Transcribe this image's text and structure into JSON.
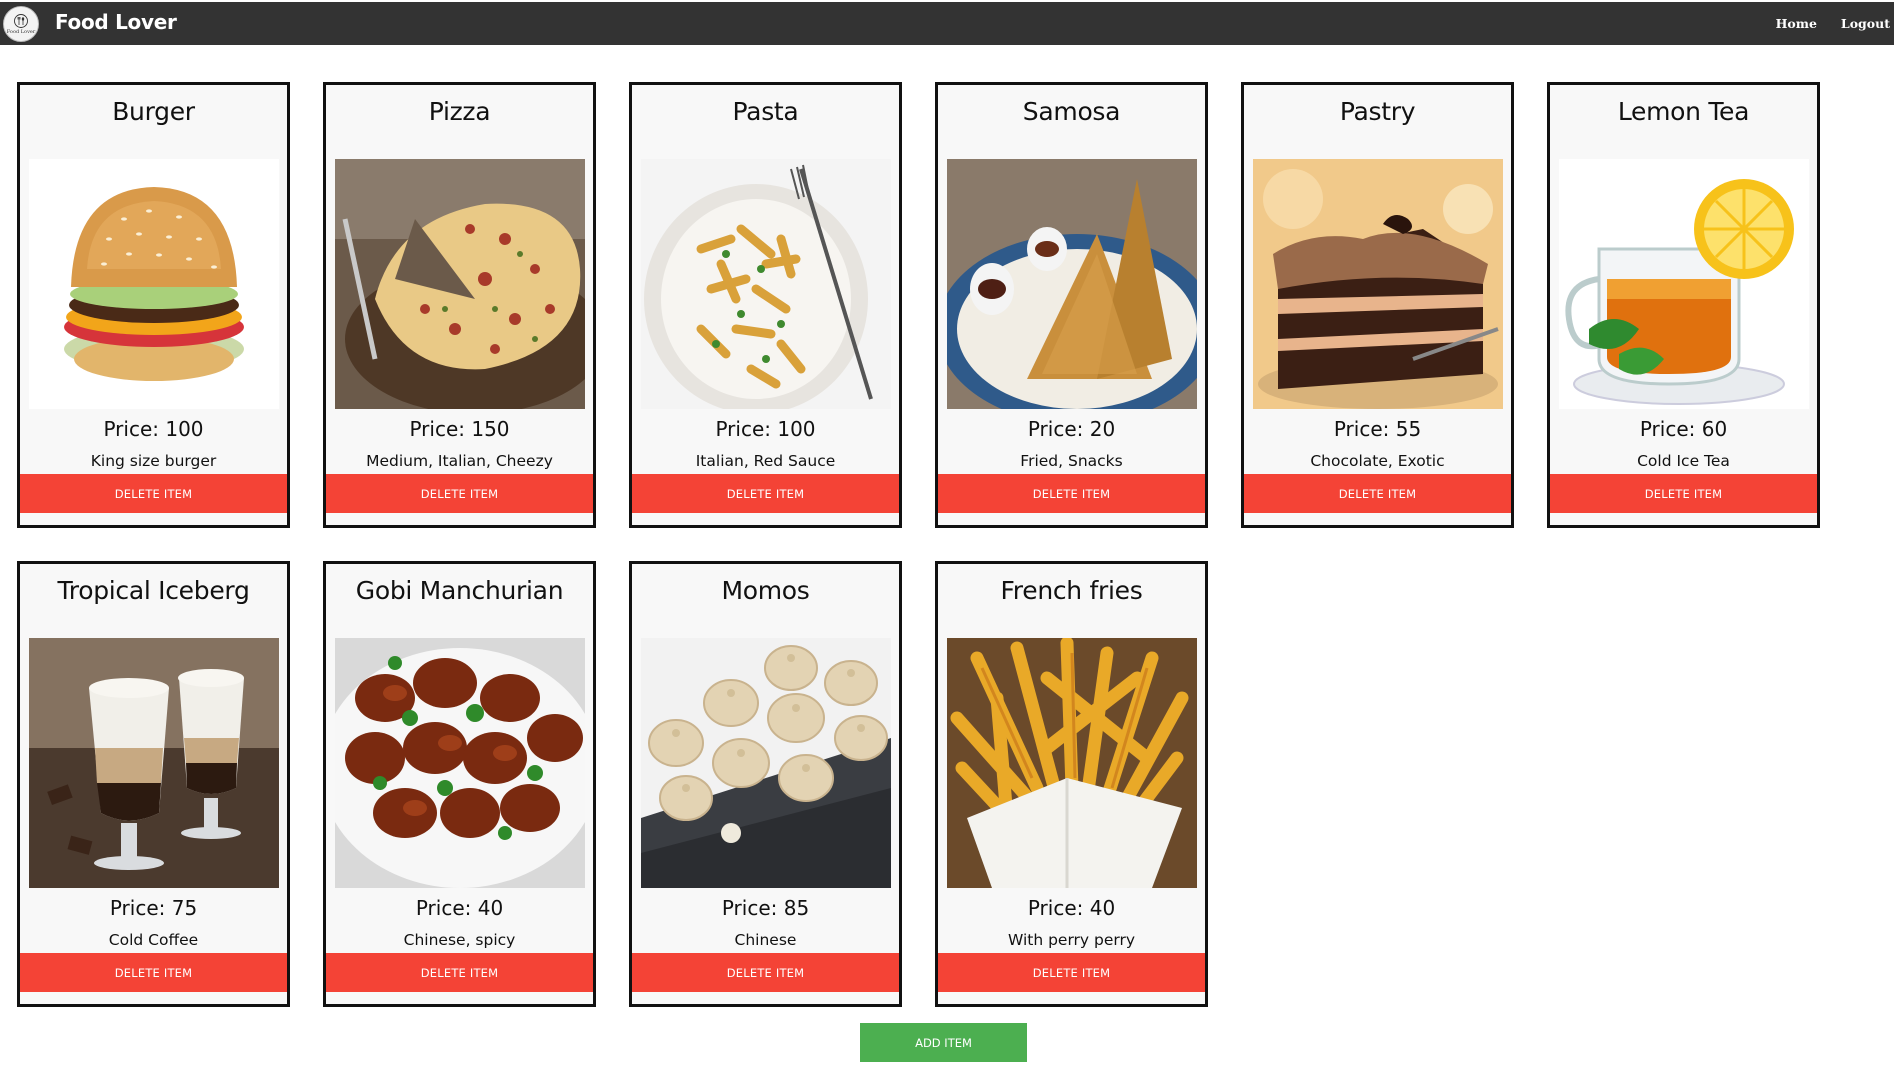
{
  "header": {
    "brand": "Food Lover",
    "logo_text": "Food Lover",
    "nav": [
      {
        "label": "Home"
      },
      {
        "label": "Logout"
      }
    ],
    "background": "#333333"
  },
  "items": [
    {
      "name": "Burger",
      "price": "Price: 100",
      "description": "King size burger",
      "delete_label": "DELETE ITEM",
      "image": "burger"
    },
    {
      "name": "Pizza",
      "price": "Price: 150",
      "description": "Medium, Italian, Cheezy",
      "delete_label": "DELETE ITEM",
      "image": "pizza"
    },
    {
      "name": "Pasta",
      "price": "Price: 100",
      "description": "Italian, Red Sauce",
      "delete_label": "DELETE ITEM",
      "image": "pasta"
    },
    {
      "name": "Samosa",
      "price": "Price: 20",
      "description": "Fried, Snacks",
      "delete_label": "DELETE ITEM",
      "image": "samosa"
    },
    {
      "name": "Pastry",
      "price": "Price: 55",
      "description": "Chocolate, Exotic",
      "delete_label": "DELETE ITEM",
      "image": "pastry"
    },
    {
      "name": "Lemon Tea",
      "price": "Price: 60",
      "description": "Cold Ice Tea",
      "delete_label": "DELETE ITEM",
      "image": "lemon-tea"
    },
    {
      "name": "Tropical Iceberg",
      "price": "Price: 75",
      "description": "Cold Coffee",
      "delete_label": "DELETE ITEM",
      "image": "cold-coffee"
    },
    {
      "name": "Gobi Manchurian",
      "price": "Price: 40",
      "description": "Chinese, spicy",
      "delete_label": "DELETE ITEM",
      "image": "gobi-manchurian"
    },
    {
      "name": "Momos",
      "price": "Price: 85",
      "description": "Chinese",
      "delete_label": "DELETE ITEM",
      "image": "momos"
    },
    {
      "name": "French fries",
      "price": "Price: 40",
      "description": "With perry perry",
      "delete_label": "DELETE ITEM",
      "image": "french-fries"
    }
  ],
  "add_button": {
    "label": "ADD ITEM"
  },
  "colors": {
    "delete": "#f44336",
    "add": "#4caf50",
    "card_border": "#111111",
    "card_bg": "#f8f8f8"
  }
}
